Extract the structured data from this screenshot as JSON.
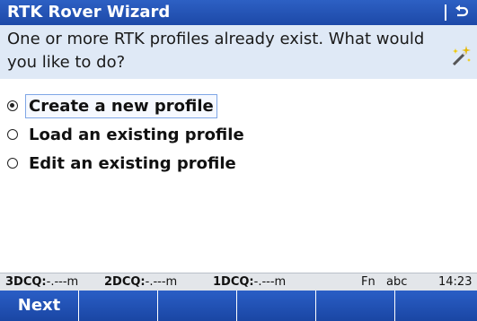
{
  "window": {
    "title": "RTK Rover Wizard",
    "back_icon": "back-arrow-icon"
  },
  "prompt": {
    "text": "One or more RTK profiles already exist.  What would you like to do?",
    "icon": "wizard-wand-icon"
  },
  "options": [
    {
      "label": "Create a new profile",
      "checked": true
    },
    {
      "label": "Load an existing profile",
      "checked": false
    },
    {
      "label": "Edit an existing profile",
      "checked": false
    }
  ],
  "status": {
    "dcq3_label": "3DCQ:",
    "dcq3_value": "-.---m",
    "dcq2_label": "2DCQ:",
    "dcq2_value": "-.---m",
    "dcq1_label": "1DCQ:",
    "dcq1_value": "-.---m",
    "fn": "Fn",
    "input_mode": "abc",
    "time": "14:23"
  },
  "softkeys": [
    "Next",
    "",
    "",
    "",
    "",
    ""
  ]
}
